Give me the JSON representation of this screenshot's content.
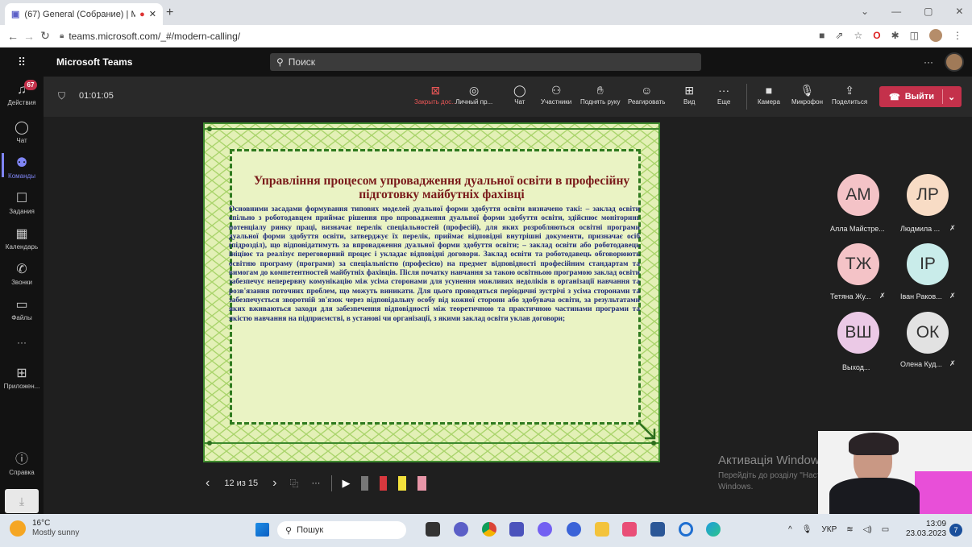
{
  "browser": {
    "tab_title": "(67) General (Собрание) | M",
    "url": "teams.microsoft.com/_#/modern-calling/"
  },
  "teams": {
    "app_name": "Microsoft Teams",
    "search_placeholder": "Поиск",
    "activity_badge": "67",
    "rail": [
      {
        "icon": "bell-icon",
        "label": "Действия"
      },
      {
        "icon": "chat-icon",
        "label": "Чат"
      },
      {
        "icon": "teams-icon",
        "label": "Команды"
      },
      {
        "icon": "tasks-icon",
        "label": "Задания"
      },
      {
        "icon": "calendar-icon",
        "label": "Календарь"
      },
      {
        "icon": "phone-icon",
        "label": "Звонки"
      },
      {
        "icon": "files-icon",
        "label": "Файлы"
      },
      {
        "icon": "more-icon",
        "label": "···"
      },
      {
        "icon": "apps-icon",
        "label": "Приложен..."
      },
      {
        "icon": "help-icon",
        "label": "Справка"
      }
    ],
    "call_timer": "01:01:05",
    "controls": [
      {
        "icon": "close-share-icon",
        "label": "Закрыть дос..."
      },
      {
        "icon": "private-icon",
        "label": "Личный пр..."
      },
      {
        "icon": "chat-icon",
        "label": "Чат"
      },
      {
        "icon": "participants-icon",
        "label": "Участники"
      },
      {
        "icon": "raise-hand-icon",
        "label": "Поднять руку"
      },
      {
        "icon": "react-icon",
        "label": "Реагировать"
      },
      {
        "icon": "view-icon",
        "label": "Вид"
      },
      {
        "icon": "more-icon",
        "label": "Еще"
      },
      {
        "icon": "camera-icon",
        "label": "Камера"
      },
      {
        "icon": "mic-icon",
        "label": "Микрофон"
      },
      {
        "icon": "share-icon",
        "label": "Поделиться"
      }
    ],
    "leave_label": "Выйти",
    "slide": {
      "title": "Управління процесом упровадження дуальної освіти в професійну підготовку майбутніх фахівці",
      "body": "Основними засадами формування типових моделей дуальної форми здобуття освіти визначено такі: – заклад освіти спільно з роботодавцем приймає рішення про впровадження дуальної форми здобуття освіти, здійснює моніторинг потенціалу ринку праці, визначає перелік спеціальностей (професій), для яких розробляються освітні програми дуальної форми здобуття освіти, затверджує їх перелік, приймає відповідні внутрішні документи, призначає осіб (підрозділ), що відповідатимуть за впровадження дуальної форми здобуття освіти; – заклад освіти або роботодавець ініціює та реалізує переговорний процес і укладає відповідні договори. Заклад освіти та роботодавець обговорюють освітню програму (програми) за спеціальністю (професією) на предмет відповідності професійним стандартам та вимогам до компетентностей майбутніх фахівців. Після початку навчання за такою освітньою програмою заклад освіти забезпечує неперервну комунікацію між усіма сторонами для усунення можливих недоліків в організації навчання та розв'язання поточних проблем, що можуть виникати. Для цього проводяться періодичні зустрічі з усіма сторонами та забезпечується зворотній зв'язок через відповідальну особу від кожної сторони або здобувача освіти, за результатами яких вживаються заходи для забезпечення відповідності між теоретичною та практичною частинами програми та якістю навчання на підприємстві, в установі чи організації, з якими заклад освіти уклав договори;"
    },
    "slide_counter": "12 из 15",
    "participants": [
      {
        "initials": "АМ",
        "name": "Алла Майстре...",
        "muted": false,
        "color": "#f4c3c7"
      },
      {
        "initials": "ЛР",
        "name": "Людмила ...",
        "muted": true,
        "color": "#f8dcc5"
      },
      {
        "initials": "ТЖ",
        "name": "Тетяна Жу...",
        "muted": true,
        "color": "#f4c3c7"
      },
      {
        "initials": "ІР",
        "name": "Іван Раков...",
        "muted": true,
        "color": "#c9ecea"
      },
      {
        "initials": "ВШ",
        "name": "Выход...",
        "muted": false,
        "color": "#ebc9e6"
      },
      {
        "initials": "ОК",
        "name": "Олена Куд...",
        "muted": true,
        "color": "#e2e2e2"
      }
    ],
    "watermark_title": "Активація Windows",
    "watermark_text_1": "Перейдіть до розділу \"Настройки\", щоб активувати",
    "watermark_text_2": "Windows."
  },
  "taskbar": {
    "temperature": "16°C",
    "weather": "Mostly sunny",
    "search_placeholder": "Пошук",
    "language": "УКР",
    "time": "13:09",
    "date": "23.03.2023",
    "notifications": "7"
  }
}
